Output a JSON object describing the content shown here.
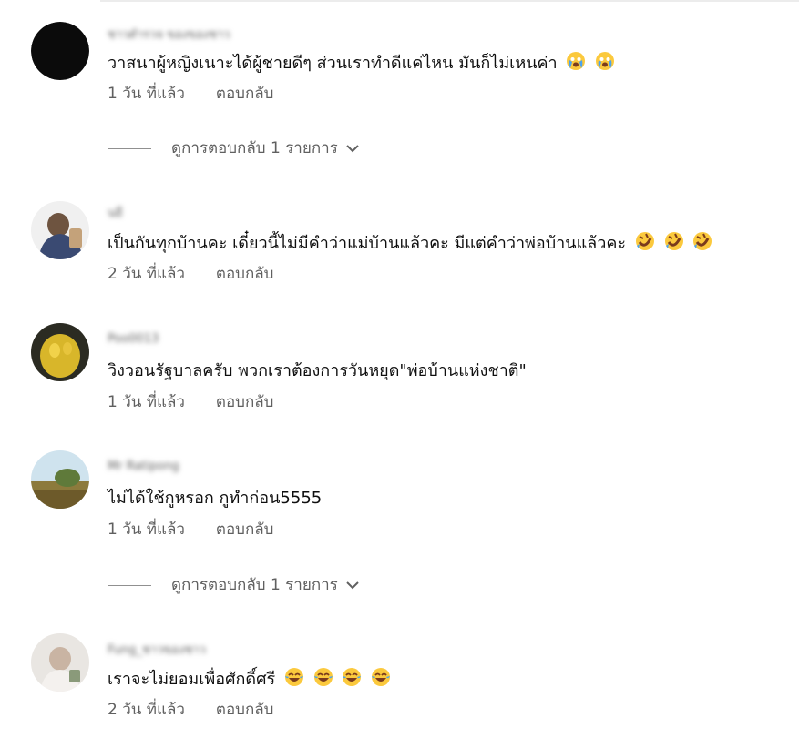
{
  "comments": [
    {
      "author": "ชาวตำรวจ ของของชาว",
      "text": "วาสนาผู้หญิงเนาะได้ผู้ชายดีๆ ส่วนเราทำดีแค่ไหน มันก็ไม่เหนค่า",
      "emoji": [
        "crying-face-icon",
        "crying-face-icon"
      ],
      "time": "1 วัน ที่แล้ว",
      "reply": "ตอบกลับ",
      "view_replies": "ดูการตอบกลับ 1 รายการ"
    },
    {
      "author": "นยี",
      "text": "เป็นกันทุกบ้านคะ เดี๋ยวนี้ไม่มีคำว่าแม่บ้านแล้วคะ มีแต่คำว่าพ่อบ้านแล้วคะ",
      "emoji": [
        "rofl-face-icon",
        "rofl-face-icon",
        "rofl-face-icon"
      ],
      "time": "2 วัน ที่แล้ว",
      "reply": "ตอบกลับ"
    },
    {
      "author": "Poo0013",
      "text": "วิงวอนรัฐบาลครับ พวกเราต้องการวันหยุด\"พ่อบ้านแห่งชาติ\"",
      "emoji": [],
      "time": "1 วัน ที่แล้ว",
      "reply": "ตอบกลับ"
    },
    {
      "author": "Mr Ratipong",
      "text": "ไม่ได้ใช้กูหรอก กูทำก่อน5555",
      "emoji": [],
      "time": "1 วัน ที่แล้ว",
      "reply": "ตอบกลับ",
      "view_replies": "ดูการตอบกลับ 1 รายการ"
    },
    {
      "author": "Fung_ชาวของชาว",
      "text": "เราจะไม่ยอมเพื่อศักดิ์ศรี",
      "emoji": [
        "tears-of-joy-icon",
        "tears-of-joy-icon",
        "tears-of-joy-icon",
        "tears-of-joy-icon"
      ],
      "time": "2 วัน ที่แล้ว",
      "reply": "ตอบกลับ"
    }
  ],
  "colors": {
    "text": "#0f0f0f",
    "secondary": "#606060",
    "emoji_yellow": "#fbc93d"
  }
}
